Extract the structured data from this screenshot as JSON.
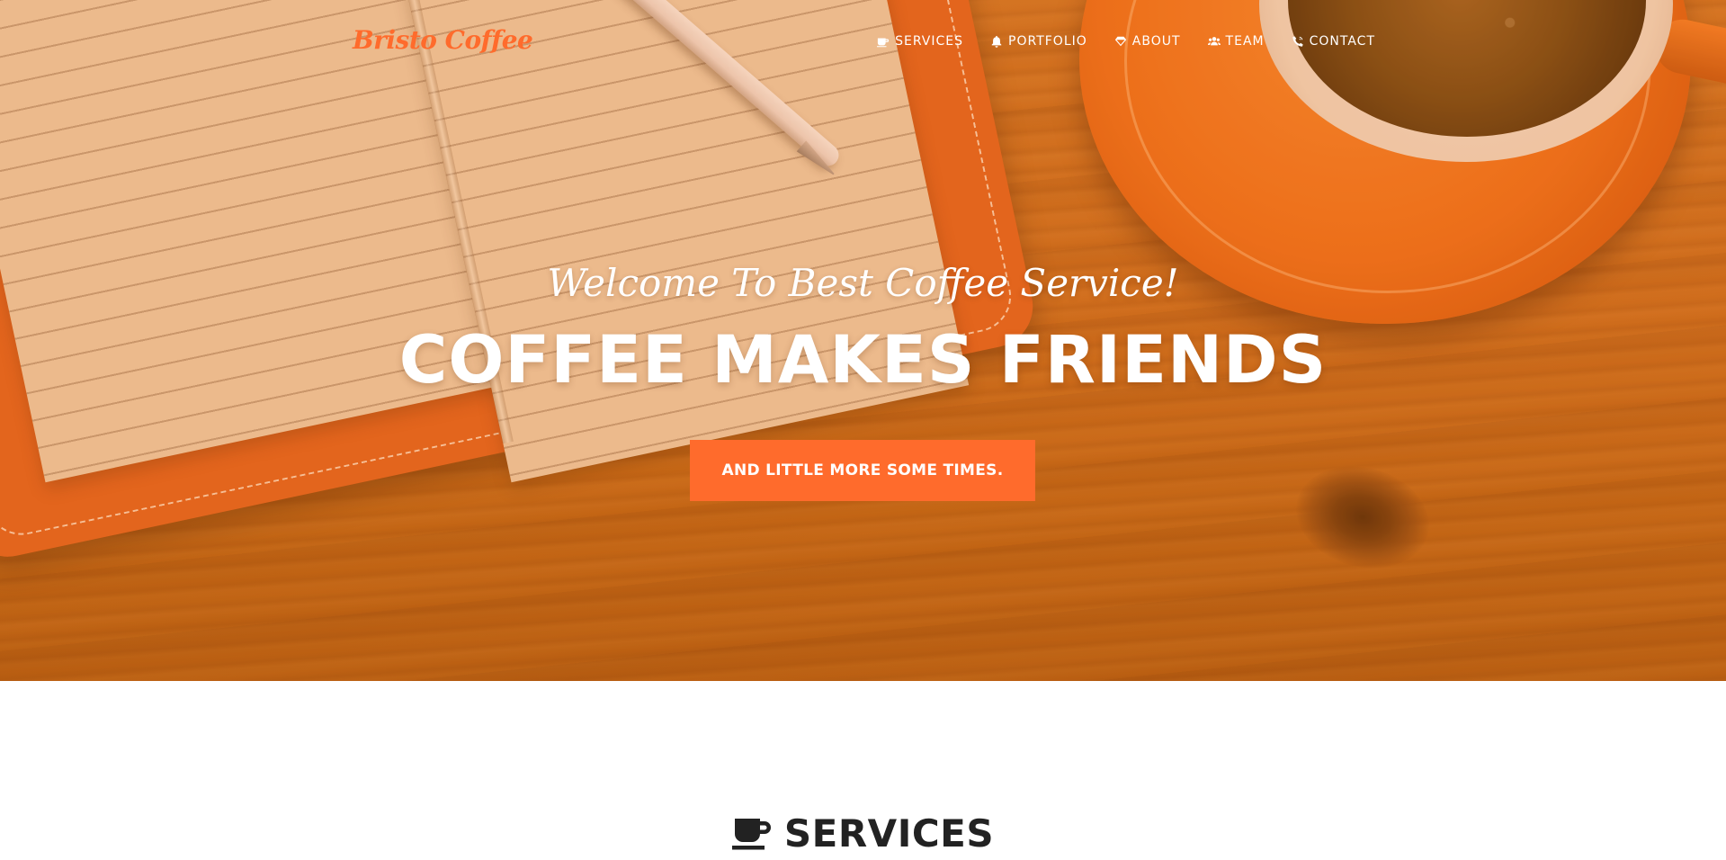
{
  "brand": {
    "name": "Bristo Coffee",
    "color": "#ff6b2c"
  },
  "nav": {
    "items": [
      {
        "label": "SERVICES",
        "icon": "coffee-cup-icon"
      },
      {
        "label": "PORTFOLIO",
        "icon": "bell-icon"
      },
      {
        "label": "ABOUT",
        "icon": "diamond-icon"
      },
      {
        "label": "TEAM",
        "icon": "users-icon"
      },
      {
        "label": "CONTACT",
        "icon": "phone-volume-icon"
      }
    ]
  },
  "hero": {
    "subheading": "Welcome To Best Coffee Service!",
    "heading": "COFFEE MAKES FRIENDS",
    "button_label": "AND LITTLE MORE SOME TIMES.",
    "accent": "#ff6b2c"
  },
  "services": {
    "title": "SERVICES",
    "icon": "coffee-cup-icon"
  }
}
